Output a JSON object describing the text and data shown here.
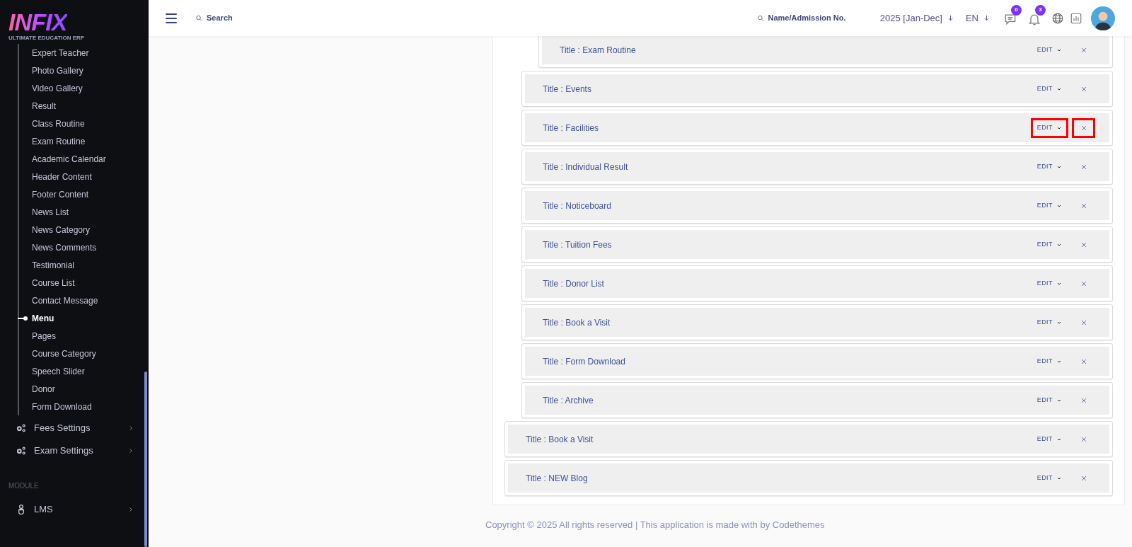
{
  "logo": {
    "wordmark": "INFIX",
    "tagline": "ULTIMATE EDUCATION ERP"
  },
  "sidebar": {
    "sub_items": [
      {
        "label": "Expert Teacher",
        "selected": false
      },
      {
        "label": "Photo Gallery",
        "selected": false
      },
      {
        "label": "Video Gallery",
        "selected": false
      },
      {
        "label": "Result",
        "selected": false
      },
      {
        "label": "Class Routine",
        "selected": false
      },
      {
        "label": "Exam Routine",
        "selected": false
      },
      {
        "label": "Academic Calendar",
        "selected": false
      },
      {
        "label": "Header Content",
        "selected": false
      },
      {
        "label": "Footer Content",
        "selected": false
      },
      {
        "label": "News List",
        "selected": false
      },
      {
        "label": "News Category",
        "selected": false
      },
      {
        "label": "News Comments",
        "selected": false
      },
      {
        "label": "Testimonial",
        "selected": false
      },
      {
        "label": "Course List",
        "selected": false
      },
      {
        "label": "Contact Message",
        "selected": false
      },
      {
        "label": "Menu",
        "selected": true
      },
      {
        "label": "Pages",
        "selected": false
      },
      {
        "label": "Course Category",
        "selected": false
      },
      {
        "label": "Speech Slider",
        "selected": false
      },
      {
        "label": "Donor",
        "selected": false
      },
      {
        "label": "Form Download",
        "selected": false
      }
    ],
    "groups": [
      {
        "label": "Fees Settings",
        "kind": "gears"
      },
      {
        "label": "Exam Settings",
        "kind": "gears"
      }
    ],
    "section_label": "MODULE",
    "modules": [
      {
        "label": "LMS",
        "kind": "person"
      }
    ]
  },
  "header": {
    "search": {
      "placeholder": "Search"
    },
    "student_search": {
      "placeholder": "Name/Admission No."
    },
    "session": "2025 [Jan-Dec]",
    "language": "EN",
    "messages_badge": "0",
    "notifications_badge": "3"
  },
  "menu_tree": [
    {
      "children": [
        {
          "children": [
            {
              "title": "Title : Exam Routine",
              "edit_label": "EDIT",
              "highlighted": false
            }
          ]
        },
        {
          "title": "Title : Events",
          "edit_label": "EDIT",
          "highlighted": false
        },
        {
          "title": "Title : Facilities",
          "edit_label": "EDIT",
          "highlighted": true
        },
        {
          "title": "Title : Individual Result",
          "edit_label": "EDIT",
          "highlighted": false
        },
        {
          "title": "Title : Noticeboard",
          "edit_label": "EDIT",
          "highlighted": false
        },
        {
          "title": "Title : Tuition Fees",
          "edit_label": "EDIT",
          "highlighted": false
        },
        {
          "title": "Title : Donor List",
          "edit_label": "EDIT",
          "highlighted": false
        },
        {
          "title": "Title : Book a Visit",
          "edit_label": "EDIT",
          "highlighted": false
        },
        {
          "title": "Title : Form Download",
          "edit_label": "EDIT",
          "highlighted": false
        },
        {
          "title": "Title : Archive",
          "edit_label": "EDIT",
          "highlighted": false
        }
      ]
    },
    {
      "title": "Title : Book a Visit",
      "edit_label": "EDIT",
      "highlighted": false
    },
    {
      "title": "Title : NEW Blog",
      "edit_label": "EDIT",
      "highlighted": false
    }
  ],
  "footer": "Copyright © 2025 All rights reserved | This application is made with by Codethemes"
}
